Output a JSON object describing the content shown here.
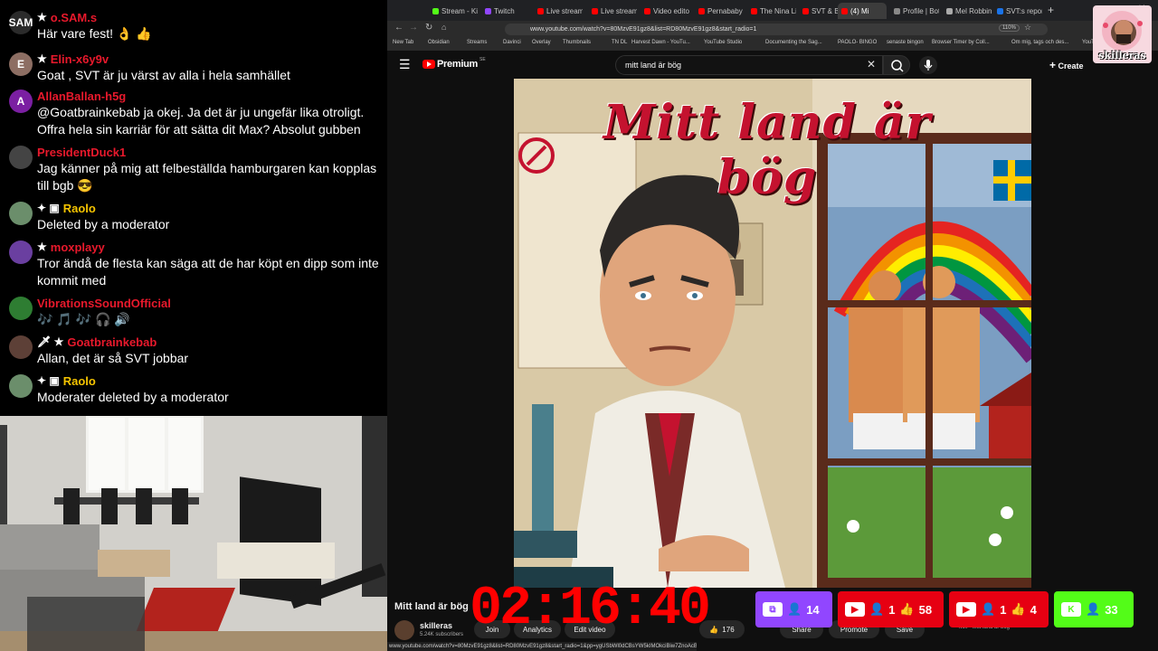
{
  "chat": {
    "messages": [
      {
        "user": "o.SAM.s",
        "badges": "★",
        "color": "#e8192c",
        "avatar_letter": "SAM",
        "avatar_bg": "#2b2b2b",
        "text": "Här vare fest! 👌 👍"
      },
      {
        "user": "Elin-x6y9v",
        "badges": "★",
        "color": "#e8192c",
        "avatar_letter": "E",
        "avatar_bg": "#8d6e63",
        "text": "Goat , SVT är ju värst av alla i hela samhället"
      },
      {
        "user": "AllanBallan-h5g",
        "badges": "",
        "color": "#e8192c",
        "avatar_letter": "A",
        "avatar_bg": "#7b1fa2",
        "text": "@Goatbrainkebab ja okej. Ja det är ju ungefär lika otroligt. Offra hela sin karriär för att sätta dit Max? Absolut gubben"
      },
      {
        "user": "PresidentDuck1",
        "badges": "",
        "color": "#e8192c",
        "avatar_letter": "",
        "avatar_bg": "#444",
        "text": "Jag känner på mig att felbeställda hamburgaren kan kopplas till bgb 😎"
      },
      {
        "user": "Raolo",
        "badges": "✦ ▣",
        "color": "#f5c400",
        "avatar_letter": "",
        "avatar_bg": "#6b8e6b",
        "text": "Deleted by a moderator"
      },
      {
        "user": "moxplayy",
        "badges": "★",
        "color": "#e8192c",
        "avatar_letter": "",
        "avatar_bg": "#6a3fa0",
        "text": "Tror ändå de flesta kan säga att de har köpt en dipp som inte kommit med"
      },
      {
        "user": "VibrationsSoundOfficial",
        "badges": "",
        "color": "#e8192c",
        "avatar_letter": "",
        "avatar_bg": "#2e7d32",
        "text": "🎶 🎵 🎶 🎧 🔊"
      },
      {
        "user": "Goatbrainkebab",
        "badges": "🗡 ★",
        "color": "#e8192c",
        "avatar_letter": "",
        "avatar_bg": "#5d4037",
        "text": "Allan, det är så SVT jobbar"
      },
      {
        "user": "Raolo",
        "badges": "✦ ▣",
        "color": "#f5c400",
        "avatar_letter": "",
        "avatar_bg": "#6b8e6b",
        "text": "Moderater deleted by a moderator"
      }
    ]
  },
  "browser": {
    "tabs": [
      {
        "label": "Stream - Kick",
        "color": "#53fc18"
      },
      {
        "label": "Twitch",
        "color": "#9146ff"
      },
      {
        "label": "Live streaming",
        "color": "#ff0000"
      },
      {
        "label": "Live streaming",
        "color": "#ff0000"
      },
      {
        "label": "Video editor",
        "color": "#ff0000"
      },
      {
        "label": "Pernababy · YouTube",
        "color": "#ff0000"
      },
      {
        "label": "The Nina Lin",
        "color": "#ff0000"
      },
      {
        "label": "SVT & Bo Gu",
        "color": "#ff0000"
      },
      {
        "label": "(4) Mi",
        "color": "#ff0000"
      },
      {
        "label": "Profile | Bot",
        "color": "#888888"
      },
      {
        "label": "Mel Robbins",
        "color": "#aaaaaa"
      },
      {
        "label": "SVT:s reports",
        "color": "#1a73e8"
      }
    ],
    "url": "www.youtube.com/watch?v=80MzvE91gz8&list=RD80MzvE91gz8&start_radio=1",
    "zoom": "110%",
    "bookmarks": [
      "New Tab",
      "Obsidian",
      "Streams",
      "Davinci",
      "Overlay",
      "Thumbnails",
      "TN DL",
      "Harvest Dawn - YouTu...",
      "YouTube Studio",
      "Documenting the Sag...",
      "PAOLO- BINGO",
      "senaste bingon",
      "Browser Timer by Coll...",
      "Om mig, tags och des...",
      "YouTube"
    ]
  },
  "youtube": {
    "logo": "Premium",
    "logo_sup": "SE",
    "search_value": "mitt land är bög",
    "create_label": "Create",
    "video_title": "Mitt land är bög",
    "channel_name": "skilleras",
    "channel_subs": "5.24K subscribers",
    "join_label": "Join",
    "analytics_label": "Analytics",
    "edit_label": "Edit video",
    "likes": "176",
    "share_label": "Share",
    "promote_label": "Promote",
    "save_label": "Save",
    "status_url": "www.youtube.com/watch?v=80MzvE91gz8&list=RD80MzvE91gz8&start_radio=1&pp=ygUSbWl0dCBsYW5kIMOkciBiw7ZnoAcB",
    "mix_label": "Mix - Mitt land är bög"
  },
  "poster": {
    "title": "Mitt land är bög"
  },
  "overlay": {
    "timer": "02:16:40",
    "twitch_viewers": "14",
    "yt1_viewers": "1",
    "yt1_likes": "58",
    "yt2_viewers": "1",
    "yt2_likes": "4",
    "kick_viewers": "33",
    "logo_text": "skilleras",
    "colors": {
      "twitch": "#9146ff",
      "youtube": "#e60012",
      "kick": "#53fc18",
      "timer": "#ff0000"
    }
  }
}
